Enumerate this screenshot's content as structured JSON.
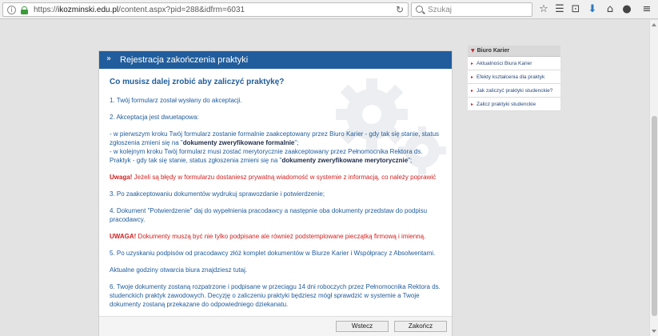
{
  "browser": {
    "url_prefix": "https://",
    "url_domain": "ikozminski.edu.pl",
    "url_path": "/content.aspx?pid=288&idfrm=6031",
    "search_placeholder": "Szukaj",
    "icons": [
      "info-icon",
      "lock-icon",
      "reload-icon",
      "search-icon",
      "bookmark-star-icon",
      "reading-list-icon",
      "home-icon",
      "pocket-icon",
      "download-icon",
      "chat-icon",
      "menu-icon"
    ]
  },
  "card": {
    "title": "Rejestracja zakończenia praktyki",
    "heading": "Co musisz dalej zrobić aby zaliczyć praktykę?",
    "p1": "1. Twój formularz został wysłany do akceptacji.",
    "p2": "2. Akceptacja jest dwuetapowa:",
    "p3a": "- w pierwszym kroku Twój formularz zostanie formalnie zaakceptowany przez Biuro Karier - gdy tak się stanie, status zgłoszenia zmieni się na \"",
    "p3a_bold": "dokumenty zweryfikowane formalnie",
    "p3a_end": "\";",
    "p3b": "- w kolejnym kroku Twój formularz musi zostać merytorycznie zaakceptowany przez Pełnomocnika Rektora ds. Praktyk - gdy tak się stanie, status zgłoszenia zmieni się na \"",
    "p3b_bold": "dokumenty zweryfikowane merytorycznie",
    "p3b_end": "\";",
    "warn1_label": "Uwaga!",
    "warn1_text": " Jeżeli są błędy w formularzu dostaniesz prywatną wiadomość w systemie z informacją, co należy poprawić",
    "p4": "3. Po zaakceptowaniu dokumentów wydrukuj sprawozdanie i potwierdzenie;",
    "p5": "4. Dokument \"Potwierdzenie\" daj do wypełnienia pracodawcy a następnie oba dokumenty przedstaw do podpisu pracodawcy.",
    "warn2_label": "UWAGA!",
    "warn2_text": " Dokumenty muszą być nie tylko podpisane ale również podstemplowane pieczątką firmową i imienną.",
    "p6": "5. Po uzyskaniu podpisów od pracodawcy złóż komplet dokumentów w Biurze Karier i Współpracy z Absolwentami.",
    "p7": "Aktualne godziny otwarcia biura znajdziesz tutaj.",
    "p8": "6. Twoje dokumenty zostaną rozpatrzone i podpisane w przeciągu 14 dni roboczych przez Pełnomocnika Rektora ds. studenckich praktyk zawodowych. Decyzję o zaliczeniu praktyki będziesz mógł sprawdzić w systemie a Twoje dokumenty zostaną przekazane do odpowiedniego dziekanatu.",
    "back_label": "Wstecz",
    "finish_label": "Zakończ"
  },
  "sidebar": {
    "title": "Biuro Karier",
    "items": [
      {
        "label": "Aktualności Biura Karier"
      },
      {
        "label": "Efekty kształcenia dla praktyk"
      },
      {
        "label": "Jak zaliczyć praktyki studenckie?"
      },
      {
        "label": "Zalicz praktyki studenckie"
      }
    ]
  },
  "colors": {
    "accent": "#215d9c",
    "warning": "#d21f1f",
    "bullet": "#c0272d",
    "background": "#e3e3e3"
  }
}
